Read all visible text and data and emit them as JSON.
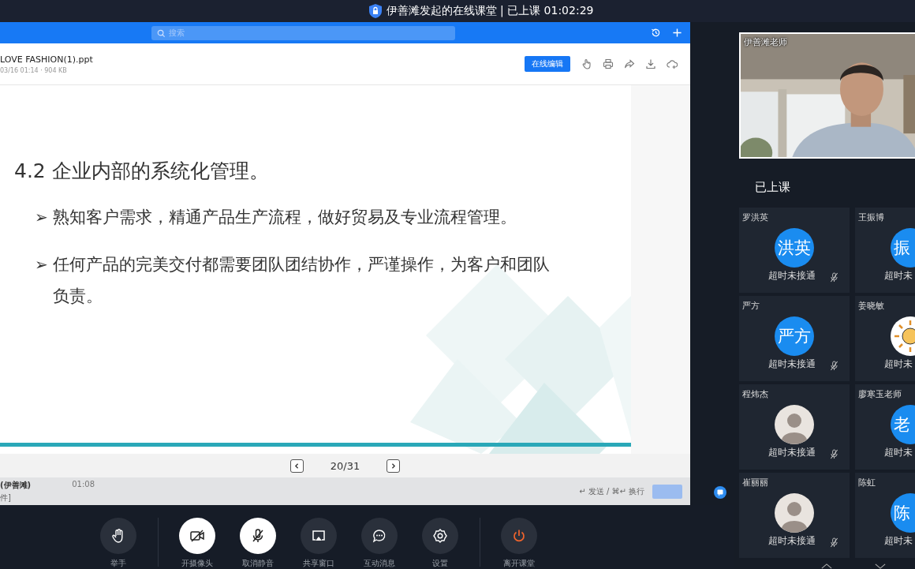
{
  "title_bar": {
    "text": "伊善滩发起的在线课堂 | 已上课 01:02:29"
  },
  "document": {
    "search": {
      "placeholder": "搜索"
    },
    "file_name": "LOVE FASHION(1).ppt",
    "file_meta": "03/16 01:14 · 904 KB",
    "edit_button": "在线编辑",
    "slide": {
      "title": "4.2 企业内部的系统化管理。",
      "bullets": [
        {
          "marker": "➢",
          "text": "熟知客户需求，精通产品生产流程，做好贸易及专业流程管理。"
        },
        {
          "marker": "➢",
          "text": "任何产品的完美交付都需要团队团结协作，严谨操作，为客户和团队负责。"
        }
      ]
    },
    "page": "20/31"
  },
  "chat": {
    "sender": "(伊善滩)",
    "time": "01:08",
    "snippet": "件]",
    "hint": "↵ 发送 / ⌘↵ 换行"
  },
  "controls": [
    {
      "kind": "hand",
      "label": "举手",
      "active": false
    },
    {
      "kind": "camera",
      "label": "开摄像头",
      "active": true
    },
    {
      "kind": "mic",
      "label": "取消静音",
      "active": true
    },
    {
      "kind": "screen",
      "label": "共享窗口",
      "active": false
    },
    {
      "kind": "chat",
      "label": "互动消息",
      "active": false
    },
    {
      "kind": "settings",
      "label": "设置",
      "active": false
    },
    {
      "kind": "leave",
      "label": "离开课堂",
      "active": false
    }
  ],
  "teacher_video": {
    "name": "伊善滩老师"
  },
  "participants_heading": "已上课",
  "participants": [
    {
      "name": "罗洪英",
      "avatar": {
        "kind": "text",
        "text": "洪英"
      },
      "status": "超时未接通",
      "muted": true
    },
    {
      "name": "王振博",
      "avatar": {
        "kind": "text",
        "text": "振"
      },
      "status": "超时未"
    },
    {
      "name": "严方",
      "avatar": {
        "kind": "text",
        "text": "严方"
      },
      "status": "超时未接通",
      "muted": true
    },
    {
      "name": "姜晓敏",
      "avatar": {
        "kind": "sun"
      },
      "status": "超时未"
    },
    {
      "name": "程炜杰",
      "status": "超时未接通",
      "muted": true
    },
    {
      "name": "廖寒玉老师",
      "avatar": {
        "kind": "text",
        "text": "老"
      },
      "status": "超时未"
    },
    {
      "name": "崔丽丽",
      "status": "超时未接通",
      "muted": true
    },
    {
      "name": "陈虹",
      "avatar": {
        "kind": "text",
        "text": "陈"
      },
      "status": "超时未"
    }
  ]
}
